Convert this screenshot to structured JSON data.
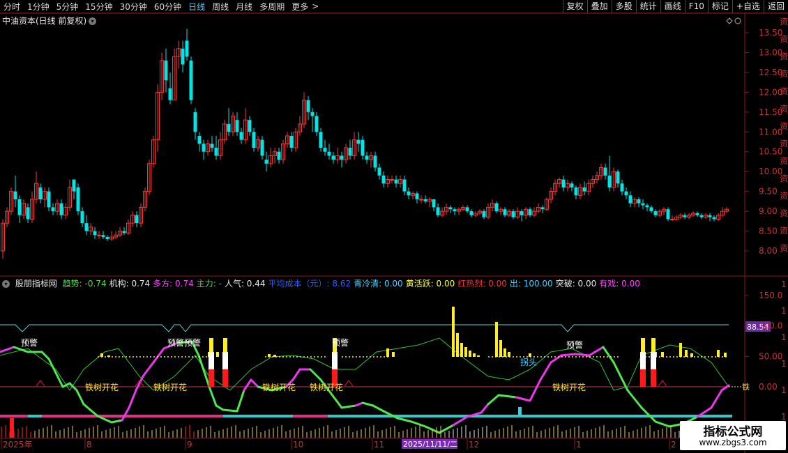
{
  "topbar": {
    "timeframes": [
      "分时",
      "1分钟",
      "5分钟",
      "15分钟",
      "30分钟",
      "60分钟",
      "日线",
      "周线",
      "月线",
      "多周期",
      "更多"
    ],
    "active": "日线",
    "more_arrow": ">",
    "tools": [
      "复权",
      "叠加",
      "多股",
      "统计",
      "画线",
      "F10",
      "标记",
      "+自选",
      "返回"
    ]
  },
  "stock": {
    "title": "中油资本(日线 前复权)"
  },
  "price_axis": [
    "13.50",
    "13.00",
    "12.50",
    "12.00",
    "11.50",
    "11.00",
    "10.50",
    "10.00",
    "9.50",
    "9.00",
    "8.50",
    "8.00"
  ],
  "indicator": {
    "name": "股朋指标网",
    "fields": [
      {
        "label": "趋势: -0.74",
        "color": "#4ddf4d"
      },
      {
        "label": "机构: 0.74",
        "color": "#e8e8e8"
      },
      {
        "label": "多方: 0.74",
        "color": "#ff40ff"
      },
      {
        "label": "主力: -",
        "color": "#4ddf4d"
      },
      {
        "label": "人气: 0.44",
        "color": "#e8e8e8"
      },
      {
        "label": "平均成本（元）: 8.62",
        "color": "#2b5cff"
      },
      {
        "label": "青冷清: 0.00",
        "color": "#46d1ff"
      },
      {
        "label": "黄活跃: 0.00",
        "color": "#ffff33"
      },
      {
        "label": "红热烈: 0.00",
        "color": "#ff3030"
      },
      {
        "label": "出: 100.00",
        "color": "#46d1ff"
      },
      {
        "label": "突破: 0.00",
        "color": "#e8e8e8"
      },
      {
        "label": "有戏: 0.00",
        "color": "#ff40ff"
      }
    ],
    "axis": [
      "150.0",
      "100.0",
      "50.00",
      "0.00"
    ],
    "value_tag": "88.54",
    "annotations": {
      "warn": "预警",
      "warn2": "预警预警",
      "bloom": "铁树开花",
      "turn": "拐头"
    }
  },
  "date_axis": {
    "labels": [
      "2025年",
      "8",
      "9",
      "10",
      "11",
      "12",
      "1",
      "2"
    ],
    "highlight": "2025/11/11/二"
  },
  "watermark": {
    "title": "指标公式网",
    "url": "www.zbgs3.com"
  },
  "colors": {
    "up": "#ff3232",
    "down": "#00e5e5",
    "grid": "#6a1010",
    "axis": "#8a1a1a"
  }
}
